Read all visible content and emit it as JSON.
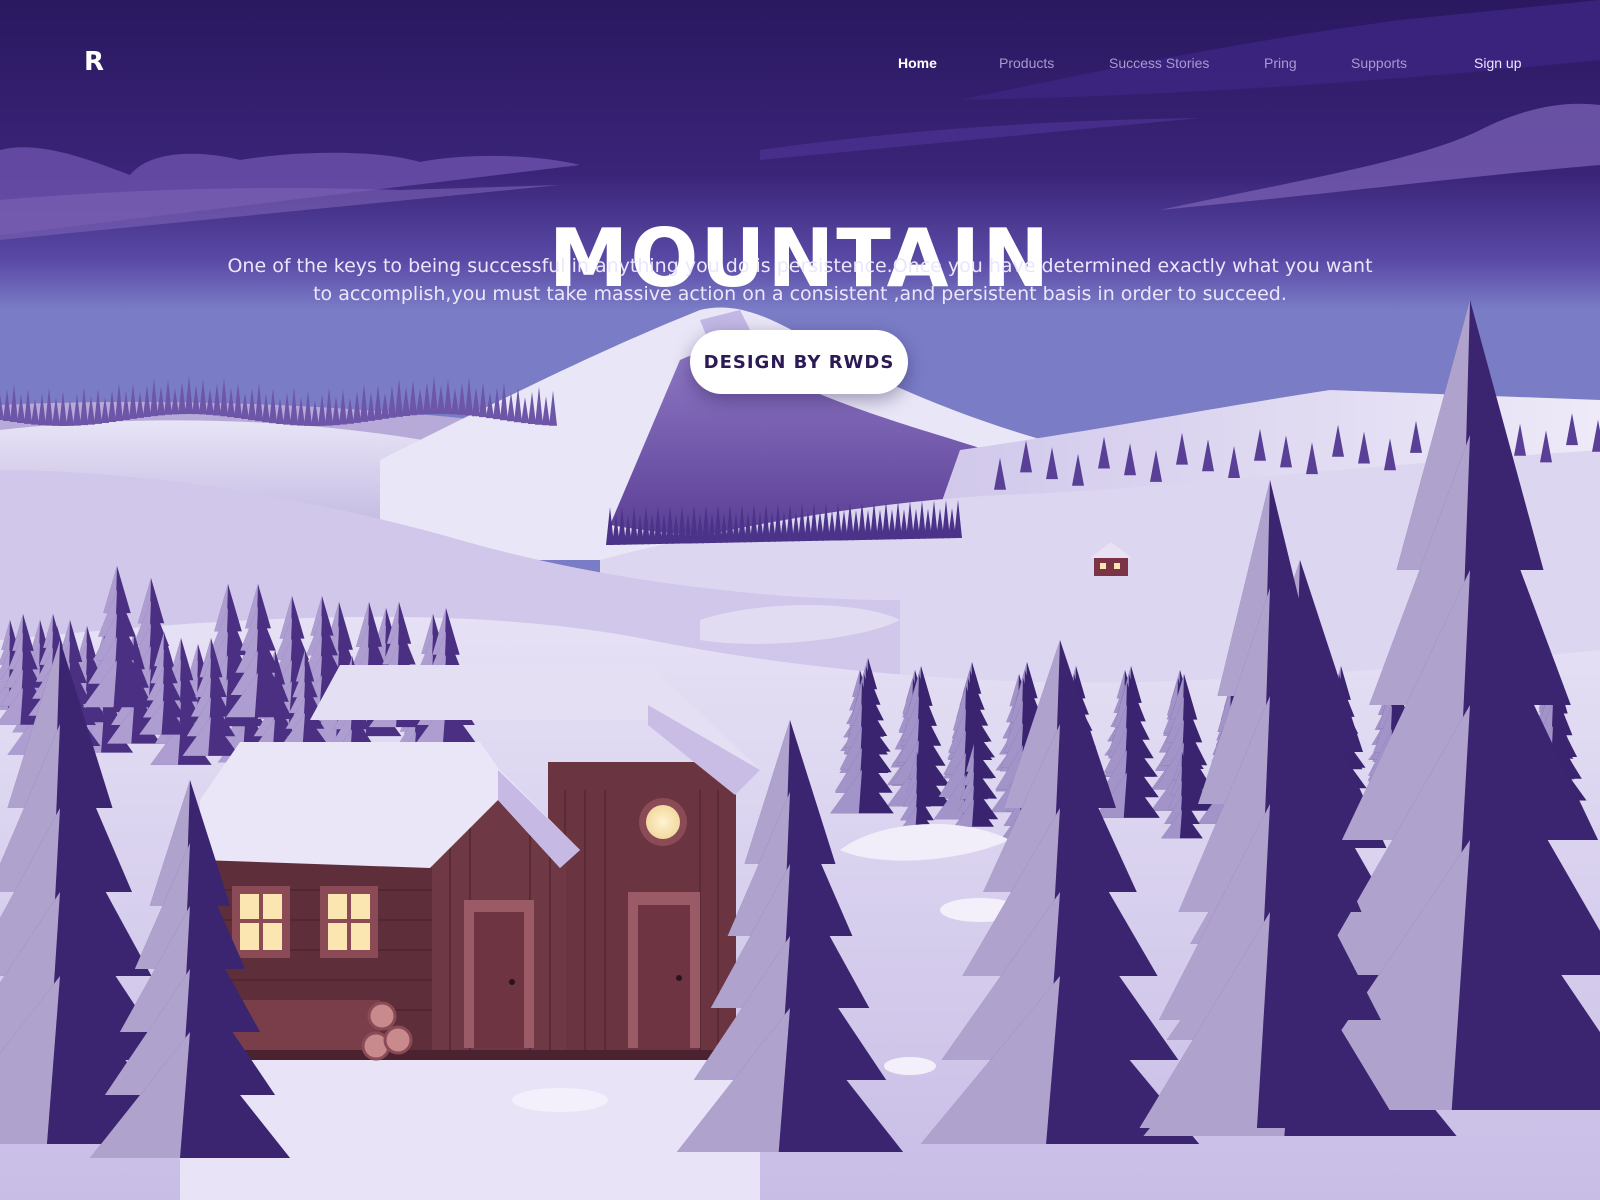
{
  "brand": {
    "logo": "R"
  },
  "nav": {
    "items": [
      {
        "label": "Home",
        "active": true
      },
      {
        "label": "Products",
        "active": false
      },
      {
        "label": "Success Stories",
        "active": false
      },
      {
        "label": "Pring",
        "active": false
      },
      {
        "label": "Supports",
        "active": false
      }
    ],
    "signup_label": "Sign up"
  },
  "hero": {
    "title": "MOUNTAIN",
    "description": "One of the keys to being successful in anything you do is persistence.Once you have determined exactly what you want to accomplish,you must take massive action on a consistent ,and persistent basis in order to succeed.",
    "cta_label": "DESIGN BY RWDS"
  },
  "colors": {
    "sky_top": "#2a1860",
    "sky_bottom": "#5a3f9a",
    "snow": "#ddd6f0",
    "cabin_wall": "#6a3440",
    "window_light": "#fbe5b0",
    "tree_dark": "#3a2470"
  }
}
